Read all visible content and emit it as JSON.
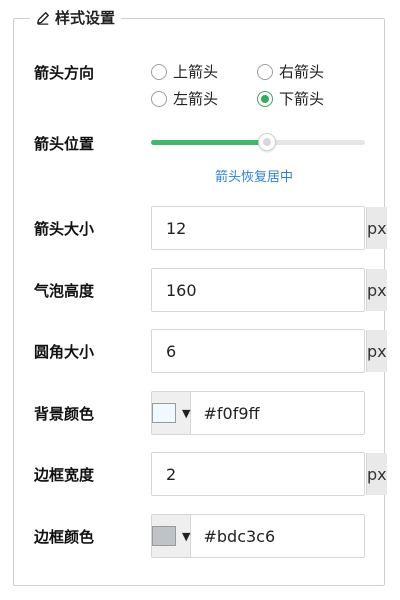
{
  "panel": {
    "title": "样式设置",
    "title_icon": "pencil-icon"
  },
  "arrow_direction": {
    "label": "箭头方向",
    "options": [
      {
        "label": "上箭头",
        "checked": false
      },
      {
        "label": "右箭头",
        "checked": false
      },
      {
        "label": "左箭头",
        "checked": false
      },
      {
        "label": "下箭头",
        "checked": true
      }
    ],
    "accent_color": "#3aa660"
  },
  "arrow_position": {
    "label": "箭头位置",
    "value_percent": 54,
    "reset_link": "箭头恢复居中",
    "fill_color": "#3dba6b"
  },
  "arrow_size": {
    "label": "箭头大小",
    "value": "12",
    "unit": "px"
  },
  "bubble_height": {
    "label": "气泡高度",
    "value": "160",
    "unit": "px"
  },
  "corner_radius": {
    "label": "圆角大小",
    "value": "6",
    "unit": "px"
  },
  "background_color": {
    "label": "背景颜色",
    "value": "#f0f9ff",
    "swatch": "#f0f9ff"
  },
  "border_width": {
    "label": "边框宽度",
    "value": "2",
    "unit": "px"
  },
  "border_color": {
    "label": "边框颜色",
    "value": "#bdc3c6",
    "swatch": "#bdc3c6"
  }
}
